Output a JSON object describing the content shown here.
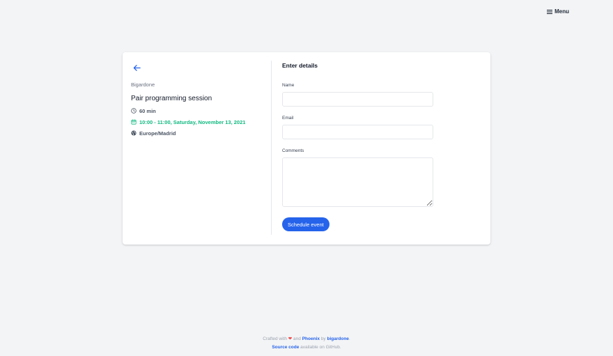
{
  "header": {
    "menu_label": "Menu",
    "menu_icon": "hamburger-icon"
  },
  "event": {
    "back_icon": "arrow-left-icon",
    "owner": "Bigardone",
    "title": "Pair programming session",
    "duration": "60 min",
    "slot": "10:00 - 11:00, Saturday, November 13, 2021",
    "timezone": "Europe/Madrid"
  },
  "form": {
    "title": "Enter details",
    "name_label": "Name",
    "name_value": "",
    "email_label": "Email",
    "email_value": "",
    "comments_label": "Comments",
    "comments_value": "",
    "submit_label": "Schedule event"
  },
  "footer": {
    "crafted_prefix": "Crafted with",
    "heart": "❤",
    "and_text": "and",
    "phoenix_link": "Phoenix",
    "by_text": "by",
    "author_link": "bigardone",
    "period": ".",
    "source_link": "Source code",
    "source_suffix": "available on GitHub."
  },
  "colors": {
    "primary": "#2563eb",
    "success": "#10b981",
    "background": "#f3f4f6",
    "heart": "#ef4444"
  }
}
